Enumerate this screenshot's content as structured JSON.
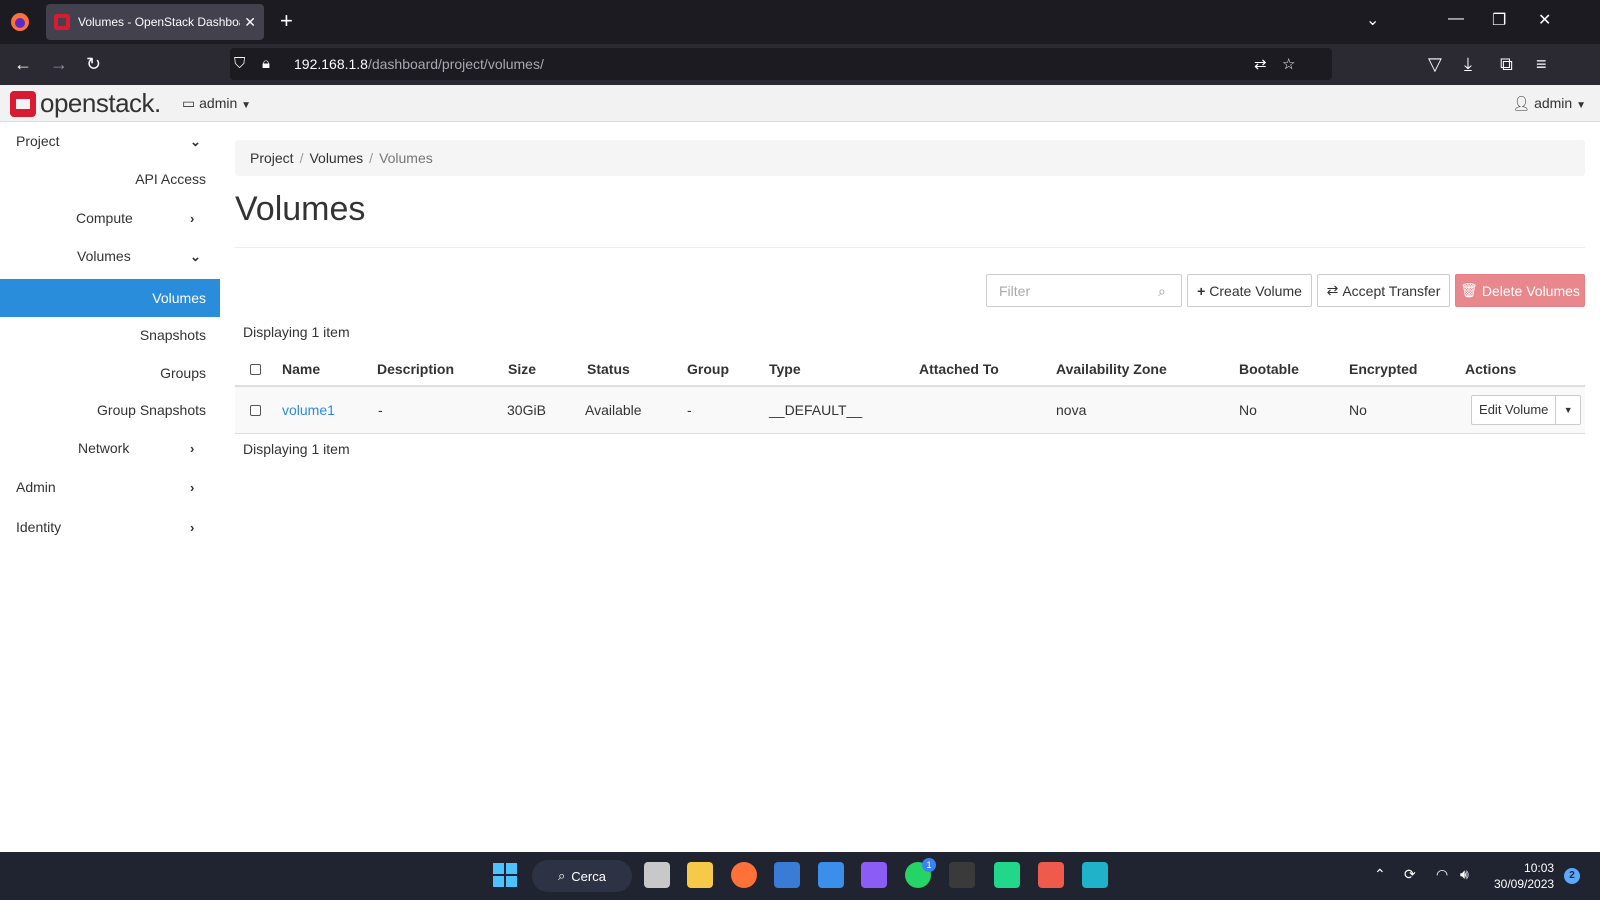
{
  "browser": {
    "tab_title": "Volumes - OpenStack Dashboard",
    "url_host": "192.168.1.8",
    "url_path": "/dashboard/project/volumes/"
  },
  "header": {
    "logo_text": "openstack.",
    "project_label": "admin",
    "user_label": "admin"
  },
  "sidebar": {
    "items": [
      {
        "label": "Project"
      },
      {
        "label": "API Access"
      },
      {
        "label": "Compute"
      },
      {
        "label": "Volumes"
      },
      {
        "label": "Volumes"
      },
      {
        "label": "Snapshots"
      },
      {
        "label": "Groups"
      },
      {
        "label": "Group Snapshots"
      },
      {
        "label": "Network"
      },
      {
        "label": "Admin"
      },
      {
        "label": "Identity"
      }
    ]
  },
  "breadcrumb": [
    "Project",
    "Volumes",
    "Volumes"
  ],
  "page_title": "Volumes",
  "toolbar": {
    "filter_placeholder": "Filter",
    "create_label": "Create Volume",
    "accept_label": "Accept Transfer",
    "delete_label": "Delete Volumes"
  },
  "table": {
    "count_text": "Displaying 1 item",
    "columns": [
      "Name",
      "Description",
      "Size",
      "Status",
      "Group",
      "Type",
      "Attached To",
      "Availability Zone",
      "Bootable",
      "Encrypted",
      "Actions"
    ],
    "rows": [
      {
        "name": "volume1",
        "description": "-",
        "size": "30GiB",
        "status": "Available",
        "group": "-",
        "type": "__DEFAULT__",
        "attached_to": "",
        "availability_zone": "nova",
        "bootable": "No",
        "encrypted": "No",
        "action": "Edit Volume"
      }
    ]
  },
  "taskbar": {
    "search_label": "Cerca",
    "time": "10:03",
    "date": "30/09/2023",
    "whatsapp_badge": "1",
    "notifications_badge": "2"
  },
  "colors": {
    "accent": "#2a8ddb",
    "danger": "#e8878c",
    "brand": "#da1a32"
  }
}
